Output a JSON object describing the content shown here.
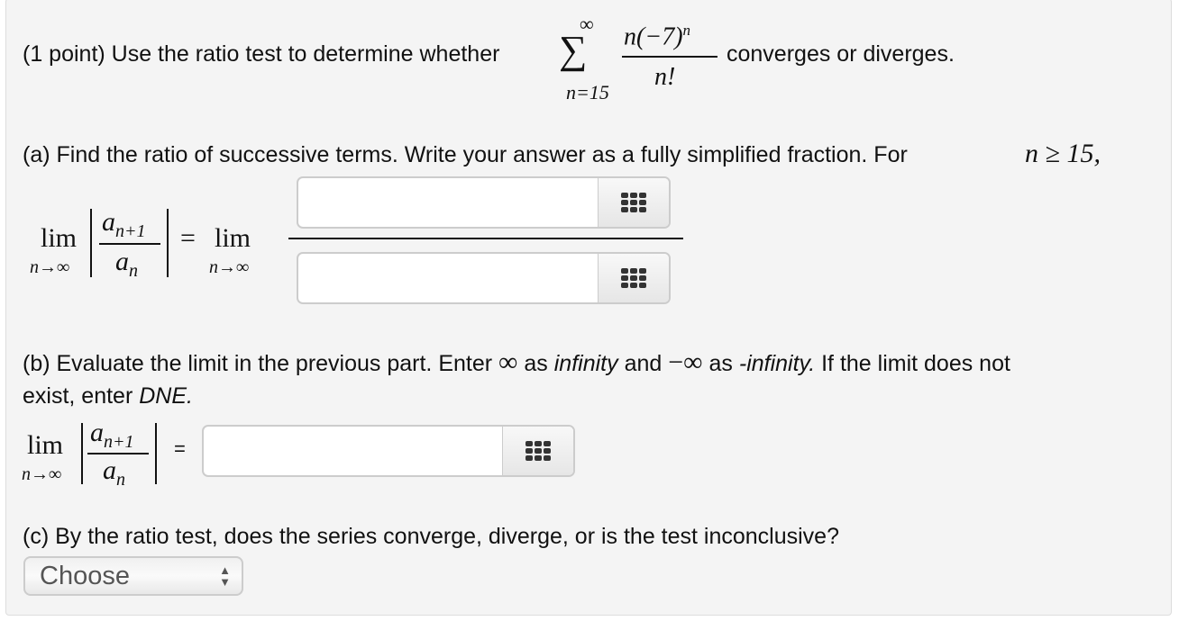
{
  "problem": {
    "intro": "(1 point) Use the ratio test to determine whether",
    "sum_upper": "∞",
    "sum_symbol": "∑",
    "sum_lower": "n=15",
    "term_num": "n(−7)",
    "term_num_exp": "n",
    "term_den": "n!",
    "intro_end": "converges or diverges."
  },
  "part_a": {
    "text": "(a) Find the ratio of successive terms. Write your answer as a fully simplified fraction. For",
    "cond": "n ≥ 15,",
    "lim": "lim",
    "lim_sub": "n→∞",
    "ratio_num": "a",
    "ratio_num_sub": "n+1",
    "ratio_den": "a",
    "ratio_den_sub": "n",
    "equals": "=",
    "lim2": "lim",
    "lim2_sub": "n→∞",
    "numerator_value": "",
    "denominator_value": ""
  },
  "part_b": {
    "text1": "(b) Evaluate the limit in the previous part. Enter",
    "inf": "∞",
    "as1": "as",
    "infinity": "infinity",
    "and": "and",
    "neginf": "−∞",
    "as2": "as",
    "neginfinity": "-infinity.",
    "text2": "If the limit does not",
    "text3": "exist, enter",
    "dne": "DNE.",
    "lim": "lim",
    "lim_sub": "n→∞",
    "ratio_num": "a",
    "ratio_num_sub": "n+1",
    "ratio_den": "a",
    "ratio_den_sub": "n",
    "equals": "=",
    "value": ""
  },
  "part_c": {
    "text": "(c) By the ratio test, does the series converge, diverge, or is the test inconclusive?",
    "select_value": "Choose"
  },
  "icons": {
    "keyboard": "equation-editor-grid-icon",
    "select": "up-down-arrows-icon"
  }
}
